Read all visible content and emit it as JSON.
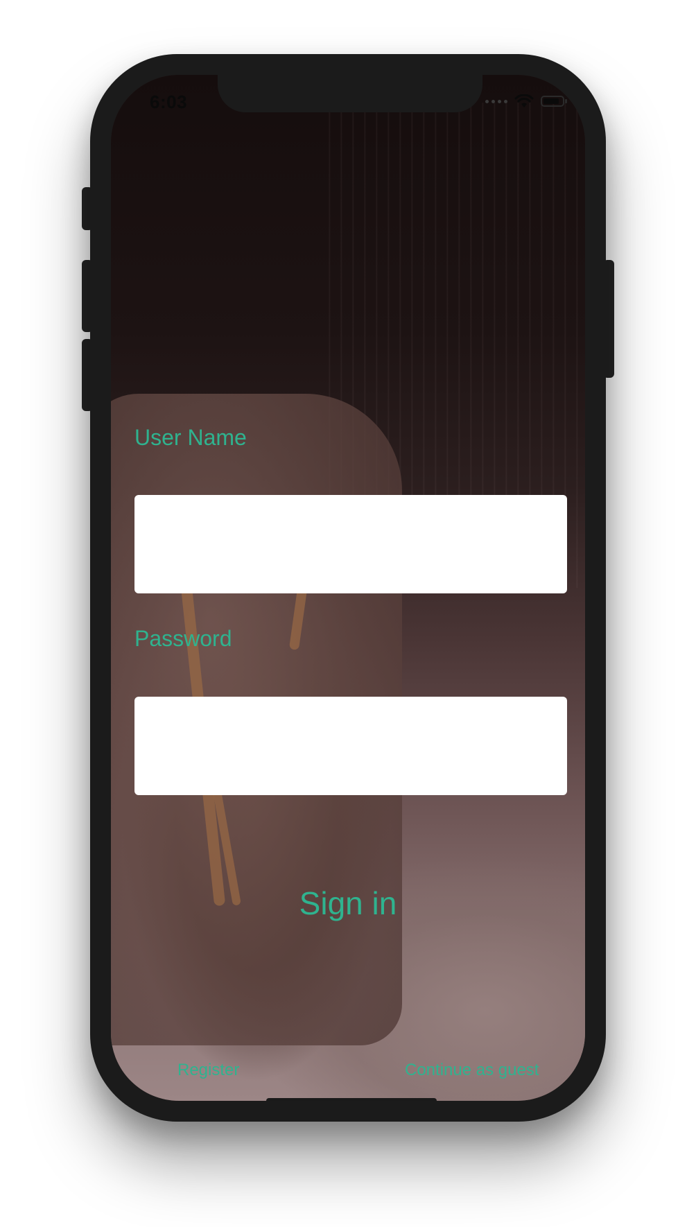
{
  "status_bar": {
    "time": "6:03"
  },
  "login": {
    "username_label": "User Name",
    "username_value": "",
    "password_label": "Password",
    "password_value": "",
    "sign_in_label": "Sign in",
    "register_label": "Register",
    "guest_label": "Continue as guest"
  },
  "colors": {
    "accent": "#2fb38f",
    "field_background": "#ffffff",
    "device_frame": "#1b1b1b"
  },
  "icons": {
    "status": [
      "cellular-signal-icon",
      "wifi-icon",
      "battery-icon"
    ]
  }
}
